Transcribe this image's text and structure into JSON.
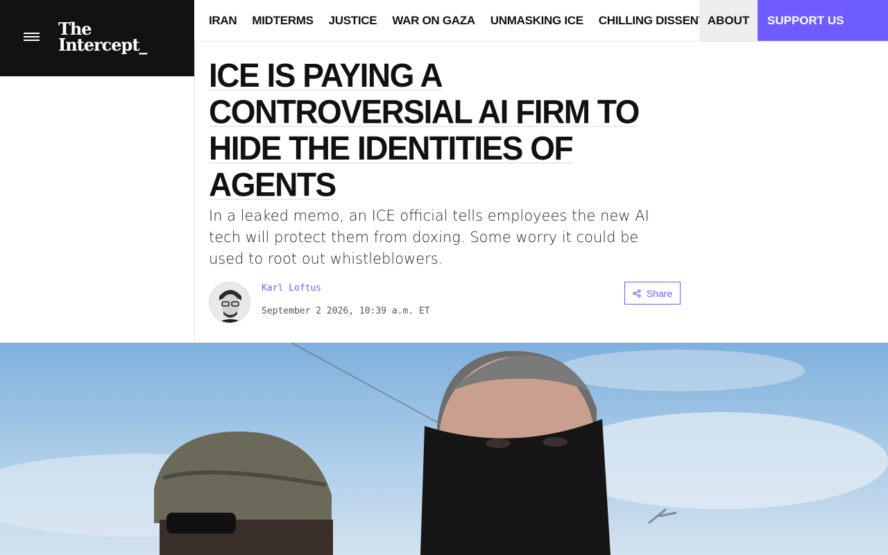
{
  "brand": {
    "logo_line1": "The",
    "logo_line2": "Intercept_"
  },
  "nav": {
    "items": [
      {
        "label": "IRAN"
      },
      {
        "label": "MIDTERMS"
      },
      {
        "label": "JUSTICE"
      },
      {
        "label": "WAR ON GAZA"
      },
      {
        "label": "UNMASKING ICE"
      },
      {
        "label": "CHILLING DISSENT"
      }
    ],
    "about": "ABOUT",
    "support": "SUPPORT US"
  },
  "article": {
    "headline_lines": [
      "ICE IS PAYING A",
      "CONTROVERSIAL AI FIRM TO",
      "HIDE THE IDENTITIES OF",
      "AGENTS"
    ],
    "dek": "In a leaked memo, an ICE official tells employees the new AI tech will protect them from doxing. Some worry it could be used to root out whistleblowers.",
    "author": "Karl Loftus",
    "date": "September 2 2026, 10:39 a.m. ET",
    "share_label": "Share"
  },
  "colors": {
    "accent": "#6f5cff",
    "brand_bg": "#121212",
    "about_bg": "#eeeeee"
  },
  "icons": {
    "menu": "hamburger-icon",
    "share": "share-icon"
  }
}
